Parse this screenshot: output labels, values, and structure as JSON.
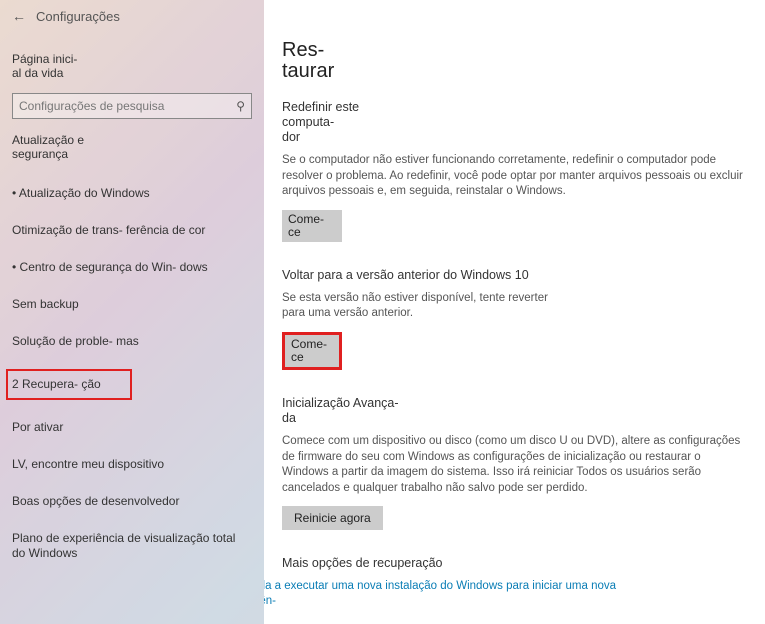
{
  "header": {
    "title": "Configurações"
  },
  "home": {
    "title": "Página inici-\nal da vida"
  },
  "search": {
    "placeholder": "Configurações de pesquisa"
  },
  "group": {
    "title": "Atualização e\nsegurança"
  },
  "nav": [
    {
      "label": "Atualização do Windows",
      "bullet": true
    },
    {
      "label": "Otimização de trans-\nferência de cor",
      "bullet": false
    },
    {
      "label": "Centro de segurança do Win-\ndows",
      "bullet": true
    },
    {
      "label": "Sem backup",
      "bullet": false
    },
    {
      "label": "Solução de proble-\nmas",
      "bullet": false
    },
    {
      "label": "2 Recupera-\nção",
      "bullet": false,
      "selected": true
    },
    {
      "label": "Por ativar",
      "bullet": false
    },
    {
      "label": "LV, encontre meu dispositivo",
      "bullet": false
    },
    {
      "label": "Boas opções de desenvolvedor",
      "bullet": false
    },
    {
      "label": "Plano de experiência de visualização total do Windows",
      "bullet": false
    }
  ],
  "main": {
    "title": "Res-\ntaurar",
    "reset": {
      "title": "Redefinir este computa-\ndor",
      "desc": "Se o computador não estiver funcionando corretamente, redefinir o computador pode resolver o problema. Ao redefinir, você pode optar por manter arquivos pessoais ou excluir arquivos pessoais e, em seguida, reinstalar o Windows.",
      "btn": "Come-\nce"
    },
    "goback": {
      "title": "Voltar para a versão anterior do Windows 10",
      "desc": "Se esta versão não estiver disponível, tente reverter para uma versão anterior.",
      "btn": "Come-\nce"
    },
    "advanced": {
      "title": "Inicialização Avança-\nda",
      "desc": "Comece com um dispositivo ou disco (como um disco U ou DVD), altere as configurações de firmware do seu com Windows as configurações de inicialização ou restaurar o Windows a partir da imagem do sistema. Isso irá reiniciar Todos os usuários serão cancelados e qualquer trabalho não salvo pode ser perdido.",
      "btn": "Reinicie agora"
    },
    "more": {
      "title": "Mais opções de recuperação",
      "link": "Aprenda a executar uma nova instalação do Windows para iniciar uma nova experiên-\ncia"
    }
  }
}
